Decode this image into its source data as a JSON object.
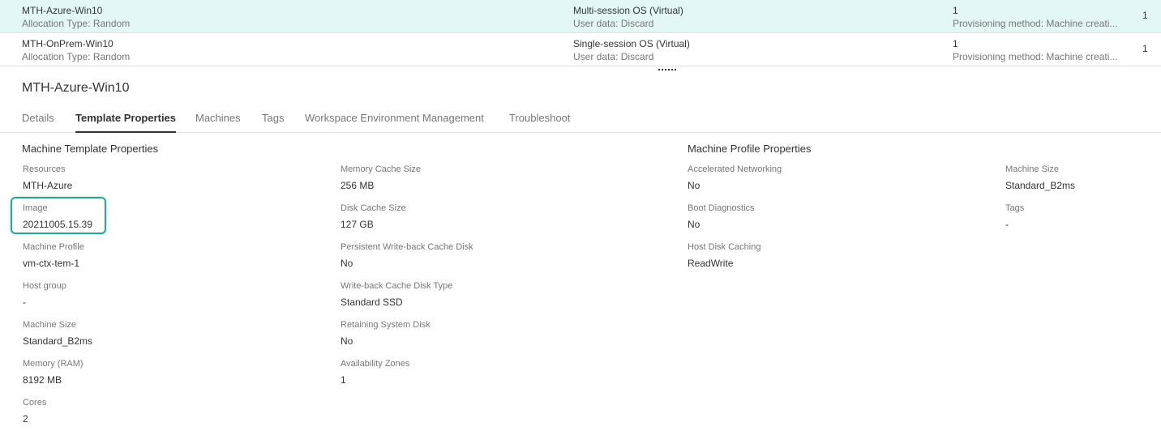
{
  "catalogs": [
    {
      "name": "MTH-Azure-Win10",
      "allocation": "Allocation Type: Random",
      "os_type": "Multi-session OS (Virtual)",
      "user_data": "User data: Discard",
      "machine_count": "1",
      "provisioning": "Provisioning method: Machine creati...",
      "extra": "1"
    },
    {
      "name": "MTH-OnPrem-Win10",
      "allocation": "Allocation Type: Random",
      "os_type": "Single-session OS (Virtual)",
      "user_data": "User data: Discard",
      "machine_count": "1",
      "provisioning": "Provisioning method: Machine creati...",
      "extra": "1"
    }
  ],
  "details": {
    "title": "MTH-Azure-Win10",
    "tabs": [
      {
        "label": "Details"
      },
      {
        "label": "Template Properties"
      },
      {
        "label": "Machines"
      },
      {
        "label": "Tags"
      },
      {
        "label": "Workspace Environment Management"
      },
      {
        "label": "Troubleshoot"
      }
    ],
    "active_tab": "Template Properties",
    "template_section_title": "Machine Template Properties",
    "profile_section_title": "Machine Profile Properties",
    "template_col1": [
      {
        "label": "Resources",
        "value": "MTH-Azure"
      },
      {
        "label": "Image",
        "value": "20211005.15.39"
      },
      {
        "label": "Machine Profile",
        "value": "vm-ctx-tem-1"
      },
      {
        "label": "Host group",
        "value": "-"
      },
      {
        "label": "Machine Size",
        "value": "Standard_B2ms"
      },
      {
        "label": "Memory (RAM)",
        "value": "8192 MB"
      },
      {
        "label": "Cores",
        "value": "2"
      }
    ],
    "template_col2": [
      {
        "label": "Memory Cache Size",
        "value": "256 MB"
      },
      {
        "label": "Disk Cache Size",
        "value": "127 GB"
      },
      {
        "label": "Persistent Write-back Cache Disk",
        "value": "No"
      },
      {
        "label": "Write-back Cache Disk Type",
        "value": "Standard SSD"
      },
      {
        "label": "Retaining System Disk",
        "value": "No"
      },
      {
        "label": "Availability Zones",
        "value": "1"
      }
    ],
    "profile_col1": [
      {
        "label": "Accelerated Networking",
        "value": "No"
      },
      {
        "label": "Boot Diagnostics",
        "value": "No"
      },
      {
        "label": "Host Disk Caching",
        "value": "ReadWrite"
      }
    ],
    "profile_col2": [
      {
        "label": "Machine Size",
        "value": "Standard_B2ms"
      },
      {
        "label": "Tags",
        "value": "-"
      }
    ]
  },
  "highlight_color": "#2aa594",
  "selected_row_color": "#e3f7f7"
}
